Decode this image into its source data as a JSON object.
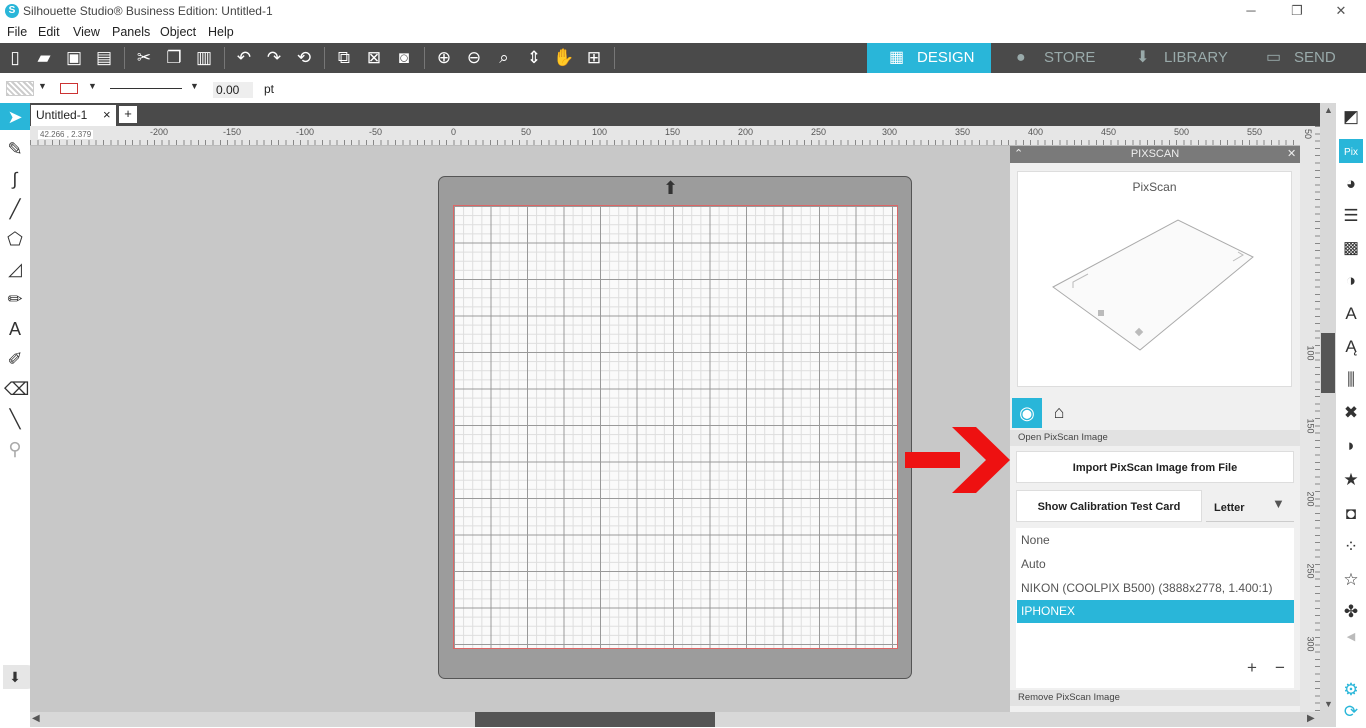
{
  "window": {
    "title": "Silhouette Studio® Business Edition: Untitled-1",
    "logo": "S",
    "min": "─",
    "restore": "❐",
    "close": "✕"
  },
  "menu": [
    "File",
    "Edit",
    "View",
    "Panels",
    "Object",
    "Help"
  ],
  "nav": {
    "design": "DESIGN",
    "store": "STORE",
    "library": "LIBRARY",
    "send": "SEND"
  },
  "props": {
    "line_width": "0.00",
    "unit": "pt"
  },
  "tab": {
    "label": "Untitled-1",
    "close": "×",
    "add": "+"
  },
  "ruler": {
    "coords": "42.266 , 2.379",
    "labels": [
      "-200",
      "-150",
      "-100",
      "-50",
      "0",
      "50",
      "100",
      "150",
      "200",
      "250",
      "300",
      "350",
      "400",
      "450",
      "500",
      "550"
    ],
    "vlabels": [
      "50",
      "100",
      "150",
      "200",
      "250",
      "300"
    ]
  },
  "panel": {
    "title": "PIXSCAN",
    "preview_title": "PixScan",
    "open_section": "Open PixScan Image",
    "import_button": "Import PixScan Image from File",
    "calibration_button": "Show Calibration Test Card",
    "paper_size": "Letter",
    "cameras": [
      "None",
      "Auto",
      "NIKON (COOLPIX B500) (3888x2778, 1.400:1)",
      "IPHONEX"
    ],
    "remove_section": "Remove PixScan Image",
    "add": "+",
    "remove": "−"
  },
  "colors": {
    "accent": "#29b6d9",
    "toolbar": "#4a4a4a",
    "arrow": "#ee1111"
  }
}
